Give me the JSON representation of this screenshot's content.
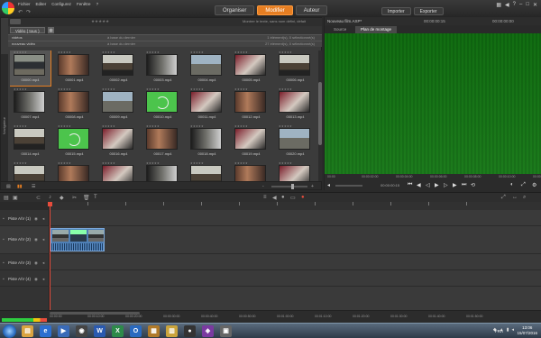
{
  "menu": [
    "Fichier",
    "Editer",
    "Configurez",
    "Fenêtre",
    "?"
  ],
  "modes": [
    "Organiser",
    "Modifier",
    "Auteur"
  ],
  "io": [
    "Importer",
    "Exporter"
  ],
  "library": {
    "tab_label": "Vidéo ( tous )",
    "rating_filter": "★★★★★",
    "filter_text": "Montrer le texte, sans nom défini, défait",
    "side_label": "Navigateur",
    "groups": [
      {
        "name": "vidéos",
        "sort": "à base du dernier",
        "count": "1 élément(s), 0 sélectionné(s)"
      },
      {
        "name": "nouveau vidéo",
        "sort": "à base du dernier",
        "count": "27 élément(s), 0 sélectionné(s)"
      }
    ],
    "clips": [
      "00000.mp4",
      "00001.mp4",
      "00002.mp4",
      "00003.mp4",
      "00004.mp4",
      "00005.mp4",
      "00006.mp4",
      "00007.mp4",
      "00008.mp4",
      "00009.mp4",
      "00010.mp4",
      "00011.mp4",
      "00012.mp4",
      "00013.mp4",
      "00014.mp4",
      "00015.mp4",
      "00016.mp4",
      "00017.mp4",
      "00018.mp4",
      "00019.mp4",
      "00020.mp4",
      "",
      "",
      "",
      "",
      "",
      "",
      ""
    ]
  },
  "player": {
    "project_title": "Nouveau film.AXP*",
    "timecode_in": "00:00:00:15",
    "timecode_out": "00:00:00:00",
    "tabs": [
      "Source",
      "Plan de montage"
    ],
    "ruler": [
      "00:00",
      "00:00:02:00",
      "00:00:04:00",
      "00:00:06:00",
      "00:00:08:00",
      "00:00:10:00",
      "00:00:11:00"
    ],
    "time_readout": "00:00:00:15"
  },
  "timeline": {
    "tracks": [
      "Piste A/V (1)",
      "Piste A/V (2)",
      "Piste A/V (3)",
      "Piste A/V (4)"
    ],
    "ruler": [
      "00:00:00",
      "00:00:10:00",
      "00:00:20:00",
      "00:00:30:00",
      "00:00:40:00",
      "00:00:50:00",
      "00:01:00:00",
      "00:01:10:00",
      "00:01:20:00",
      "00:01:30:00",
      "00:01:40:00",
      "00:01:50:00"
    ]
  },
  "taskbar": {
    "lang": "FRA",
    "time": "13:06",
    "date": "15/07/2016"
  },
  "colors": {
    "accent": "#e67e22",
    "preview": "#127212",
    "clip": "#4e7fb5",
    "playhead": "#e74c3c"
  }
}
